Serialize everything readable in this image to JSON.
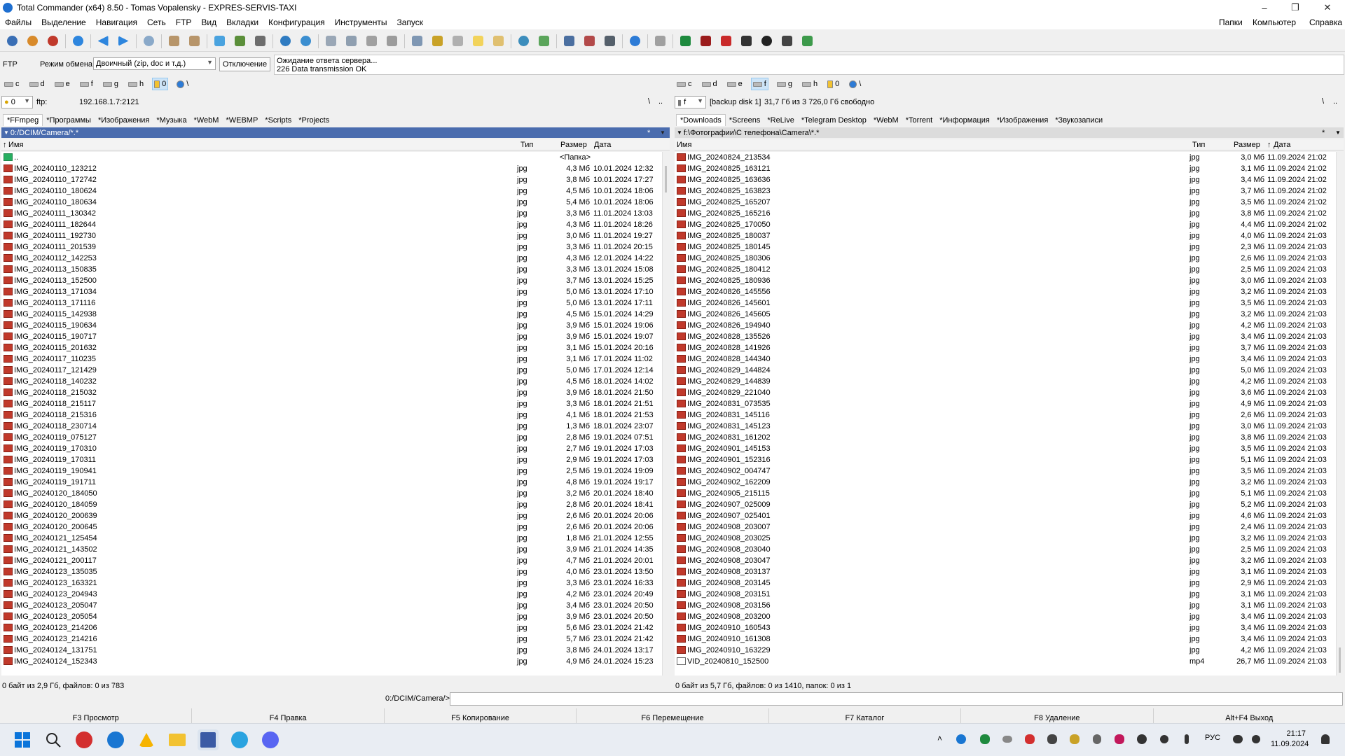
{
  "window": {
    "title": "Total Commander (x64) 8.50 - Tomas Vopalensky - EXPRES-SERVIS-TAXI"
  },
  "menu": {
    "left": [
      "Файлы",
      "Выделение",
      "Навигация",
      "Сеть",
      "FTP",
      "Вид",
      "Вкладки",
      "Конфигурация",
      "Инструменты",
      "Запуск"
    ],
    "right": [
      "Папки",
      "Компьютер",
      "Справка"
    ]
  },
  "ftp": {
    "label": "FTP",
    "mode_label": "Режим обмена",
    "mode_value": "Двоичный (zip, doc и т.д.)",
    "disconnect": "Отключение",
    "log_line1": "Ожидание ответа сервера...",
    "log_line2": "226 Data transmission OK"
  },
  "left": {
    "drives": [
      "c",
      "d",
      "e",
      "f",
      "g",
      "h",
      "0",
      "\\"
    ],
    "active_drive": "0",
    "drive_combo": "0",
    "path_prefix": "ftp:",
    "address": "192.168.1.7:2121",
    "root_btn": "\\",
    "up_btn": "..",
    "tabs": [
      "*FFmpeg",
      "*Программы",
      "*Изображения",
      "*Музыка",
      "*WebM",
      "*WEBMP",
      "*Scripts",
      "*Projects"
    ],
    "active_tab": 0,
    "header_path": "0:/DCIM/Camera/*.*",
    "header_star": "*",
    "col_name": "Имя",
    "col_type": "Тип",
    "col_size": "Размер",
    "col_date": "Дата",
    "parent": {
      "name": "..",
      "size": "<Папка>"
    },
    "files": [
      [
        "IMG_20240110_123212",
        "jpg",
        "4,3 Мб",
        "10.01.2024 12:32"
      ],
      [
        "IMG_20240110_172742",
        "jpg",
        "3,8 Мб",
        "10.01.2024 17:27"
      ],
      [
        "IMG_20240110_180624",
        "jpg",
        "4,5 Мб",
        "10.01.2024 18:06"
      ],
      [
        "IMG_20240110_180634",
        "jpg",
        "5,4 Мб",
        "10.01.2024 18:06"
      ],
      [
        "IMG_20240111_130342",
        "jpg",
        "3,3 Мб",
        "11.01.2024 13:03"
      ],
      [
        "IMG_20240111_182644",
        "jpg",
        "4,3 Мб",
        "11.01.2024 18:26"
      ],
      [
        "IMG_20240111_192730",
        "jpg",
        "3,0 Мб",
        "11.01.2024 19:27"
      ],
      [
        "IMG_20240111_201539",
        "jpg",
        "3,3 Мб",
        "11.01.2024 20:15"
      ],
      [
        "IMG_20240112_142253",
        "jpg",
        "4,3 Мб",
        "12.01.2024 14:22"
      ],
      [
        "IMG_20240113_150835",
        "jpg",
        "3,3 Мб",
        "13.01.2024 15:08"
      ],
      [
        "IMG_20240113_152500",
        "jpg",
        "3,7 Мб",
        "13.01.2024 15:25"
      ],
      [
        "IMG_20240113_171034",
        "jpg",
        "5,0 Мб",
        "13.01.2024 17:10"
      ],
      [
        "IMG_20240113_171116",
        "jpg",
        "5,0 Мб",
        "13.01.2024 17:11"
      ],
      [
        "IMG_20240115_142938",
        "jpg",
        "4,5 Мб",
        "15.01.2024 14:29"
      ],
      [
        "IMG_20240115_190634",
        "jpg",
        "3,9 Мб",
        "15.01.2024 19:06"
      ],
      [
        "IMG_20240115_190717",
        "jpg",
        "3,9 Мб",
        "15.01.2024 19:07"
      ],
      [
        "IMG_20240115_201632",
        "jpg",
        "3,1 Мб",
        "15.01.2024 20:16"
      ],
      [
        "IMG_20240117_110235",
        "jpg",
        "3,1 Мб",
        "17.01.2024 11:02"
      ],
      [
        "IMG_20240117_121429",
        "jpg",
        "5,0 Мб",
        "17.01.2024 12:14"
      ],
      [
        "IMG_20240118_140232",
        "jpg",
        "4,5 Мб",
        "18.01.2024 14:02"
      ],
      [
        "IMG_20240118_215032",
        "jpg",
        "3,9 Мб",
        "18.01.2024 21:50"
      ],
      [
        "IMG_20240118_215117",
        "jpg",
        "3,3 Мб",
        "18.01.2024 21:51"
      ],
      [
        "IMG_20240118_215316",
        "jpg",
        "4,1 Мб",
        "18.01.2024 21:53"
      ],
      [
        "IMG_20240118_230714",
        "jpg",
        "1,3 Мб",
        "18.01.2024 23:07"
      ],
      [
        "IMG_20240119_075127",
        "jpg",
        "2,8 Мб",
        "19.01.2024 07:51"
      ],
      [
        "IMG_20240119_170310",
        "jpg",
        "2,7 Мб",
        "19.01.2024 17:03"
      ],
      [
        "IMG_20240119_170311",
        "jpg",
        "2,9 Мб",
        "19.01.2024 17:03"
      ],
      [
        "IMG_20240119_190941",
        "jpg",
        "2,5 Мб",
        "19.01.2024 19:09"
      ],
      [
        "IMG_20240119_191711",
        "jpg",
        "4,8 Мб",
        "19.01.2024 19:17"
      ],
      [
        "IMG_20240120_184050",
        "jpg",
        "3,2 Мб",
        "20.01.2024 18:40"
      ],
      [
        "IMG_20240120_184059",
        "jpg",
        "2,8 Мб",
        "20.01.2024 18:41"
      ],
      [
        "IMG_20240120_200639",
        "jpg",
        "2,6 Мб",
        "20.01.2024 20:06"
      ],
      [
        "IMG_20240120_200645",
        "jpg",
        "2,6 Мб",
        "20.01.2024 20:06"
      ],
      [
        "IMG_20240121_125454",
        "jpg",
        "1,8 Мб",
        "21.01.2024 12:55"
      ],
      [
        "IMG_20240121_143502",
        "jpg",
        "3,9 Мб",
        "21.01.2024 14:35"
      ],
      [
        "IMG_20240121_200117",
        "jpg",
        "4,7 Мб",
        "21.01.2024 20:01"
      ],
      [
        "IMG_20240123_135035",
        "jpg",
        "4,0 Мб",
        "23.01.2024 13:50"
      ],
      [
        "IMG_20240123_163321",
        "jpg",
        "3,3 Мб",
        "23.01.2024 16:33"
      ],
      [
        "IMG_20240123_204943",
        "jpg",
        "4,2 Мб",
        "23.01.2024 20:49"
      ],
      [
        "IMG_20240123_205047",
        "jpg",
        "3,4 Мб",
        "23.01.2024 20:50"
      ],
      [
        "IMG_20240123_205054",
        "jpg",
        "3,9 Мб",
        "23.01.2024 20:50"
      ],
      [
        "IMG_20240123_214206",
        "jpg",
        "5,6 Мб",
        "23.01.2024 21:42"
      ],
      [
        "IMG_20240123_214216",
        "jpg",
        "5,7 Мб",
        "23.01.2024 21:42"
      ],
      [
        "IMG_20240124_131751",
        "jpg",
        "3,8 Мб",
        "24.01.2024 13:17"
      ],
      [
        "IMG_20240124_152343",
        "jpg",
        "4,9 Мб",
        "24.01.2024 15:23"
      ]
    ],
    "status": "0 байт из 2,9 Гб, файлов: 0 из 783"
  },
  "right": {
    "drives": [
      "c",
      "d",
      "e",
      "f",
      "g",
      "h",
      "0",
      "\\"
    ],
    "active_drive": "f",
    "drive_combo": "f",
    "disk_label": "[backup disk 1]",
    "free_space": "31,7 Гб из 3 726,0 Гб свободно",
    "root_btn": "\\",
    "up_btn": "..",
    "tabs": [
      "*Downloads",
      "*Screens",
      "*ReLive",
      "*Telegram Desktop",
      "*WebM",
      "*Torrent",
      "*Информация",
      "*Изображения",
      "*Звукозаписи"
    ],
    "active_tab": 0,
    "header_path": "f:\\Фотографии\\С телефона\\Camera\\*.*",
    "header_star": "*",
    "col_name": "Имя",
    "col_type": "Тип",
    "col_size": "Размер",
    "col_date": "Дата",
    "files": [
      [
        "IMG_20240824_213534",
        "jpg",
        "3,0 Мб",
        "11.09.2024 21:02"
      ],
      [
        "IMG_20240825_163121",
        "jpg",
        "3,1 Мб",
        "11.09.2024 21:02"
      ],
      [
        "IMG_20240825_163636",
        "jpg",
        "3,4 Мб",
        "11.09.2024 21:02"
      ],
      [
        "IMG_20240825_163823",
        "jpg",
        "3,7 Мб",
        "11.09.2024 21:02"
      ],
      [
        "IMG_20240825_165207",
        "jpg",
        "3,5 Мб",
        "11.09.2024 21:02"
      ],
      [
        "IMG_20240825_165216",
        "jpg",
        "3,8 Мб",
        "11.09.2024 21:02"
      ],
      [
        "IMG_20240825_170050",
        "jpg",
        "4,4 Мб",
        "11.09.2024 21:02"
      ],
      [
        "IMG_20240825_180037",
        "jpg",
        "4,0 Мб",
        "11.09.2024 21:03"
      ],
      [
        "IMG_20240825_180145",
        "jpg",
        "2,3 Мб",
        "11.09.2024 21:03"
      ],
      [
        "IMG_20240825_180306",
        "jpg",
        "2,6 Мб",
        "11.09.2024 21:03"
      ],
      [
        "IMG_20240825_180412",
        "jpg",
        "2,5 Мб",
        "11.09.2024 21:03"
      ],
      [
        "IMG_20240825_180936",
        "jpg",
        "3,0 Мб",
        "11.09.2024 21:03"
      ],
      [
        "IMG_20240826_145556",
        "jpg",
        "3,2 Мб",
        "11.09.2024 21:03"
      ],
      [
        "IMG_20240826_145601",
        "jpg",
        "3,5 Мб",
        "11.09.2024 21:03"
      ],
      [
        "IMG_20240826_145605",
        "jpg",
        "3,2 Мб",
        "11.09.2024 21:03"
      ],
      [
        "IMG_20240826_194940",
        "jpg",
        "4,2 Мб",
        "11.09.2024 21:03"
      ],
      [
        "IMG_20240828_135526",
        "jpg",
        "3,4 Мб",
        "11.09.2024 21:03"
      ],
      [
        "IMG_20240828_141926",
        "jpg",
        "3,7 Мб",
        "11.09.2024 21:03"
      ],
      [
        "IMG_20240828_144340",
        "jpg",
        "3,4 Мб",
        "11.09.2024 21:03"
      ],
      [
        "IMG_20240829_144824",
        "jpg",
        "5,0 Мб",
        "11.09.2024 21:03"
      ],
      [
        "IMG_20240829_144839",
        "jpg",
        "4,2 Мб",
        "11.09.2024 21:03"
      ],
      [
        "IMG_20240829_221040",
        "jpg",
        "3,6 Мб",
        "11.09.2024 21:03"
      ],
      [
        "IMG_20240831_073535",
        "jpg",
        "4,9 Мб",
        "11.09.2024 21:03"
      ],
      [
        "IMG_20240831_145116",
        "jpg",
        "2,6 Мб",
        "11.09.2024 21:03"
      ],
      [
        "IMG_20240831_145123",
        "jpg",
        "3,0 Мб",
        "11.09.2024 21:03"
      ],
      [
        "IMG_20240831_161202",
        "jpg",
        "3,8 Мб",
        "11.09.2024 21:03"
      ],
      [
        "IMG_20240901_145153",
        "jpg",
        "3,5 Мб",
        "11.09.2024 21:03"
      ],
      [
        "IMG_20240901_152316",
        "jpg",
        "5,1 Мб",
        "11.09.2024 21:03"
      ],
      [
        "IMG_20240902_004747",
        "jpg",
        "3,5 Мб",
        "11.09.2024 21:03"
      ],
      [
        "IMG_20240902_162209",
        "jpg",
        "3,2 Мб",
        "11.09.2024 21:03"
      ],
      [
        "IMG_20240905_215115",
        "jpg",
        "5,1 Мб",
        "11.09.2024 21:03"
      ],
      [
        "IMG_20240907_025009",
        "jpg",
        "5,2 Мб",
        "11.09.2024 21:03"
      ],
      [
        "IMG_20240907_025401",
        "jpg",
        "4,6 Мб",
        "11.09.2024 21:03"
      ],
      [
        "IMG_20240908_203007",
        "jpg",
        "2,4 Мб",
        "11.09.2024 21:03"
      ],
      [
        "IMG_20240908_203025",
        "jpg",
        "3,2 Мб",
        "11.09.2024 21:03"
      ],
      [
        "IMG_20240908_203040",
        "jpg",
        "2,5 Мб",
        "11.09.2024 21:03"
      ],
      [
        "IMG_20240908_203047",
        "jpg",
        "3,2 Мб",
        "11.09.2024 21:03"
      ],
      [
        "IMG_20240908_203137",
        "jpg",
        "3,1 Мб",
        "11.09.2024 21:03"
      ],
      [
        "IMG_20240908_203145",
        "jpg",
        "2,9 Мб",
        "11.09.2024 21:03"
      ],
      [
        "IMG_20240908_203151",
        "jpg",
        "3,1 Мб",
        "11.09.2024 21:03"
      ],
      [
        "IMG_20240908_203156",
        "jpg",
        "3,1 Мб",
        "11.09.2024 21:03"
      ],
      [
        "IMG_20240908_203200",
        "jpg",
        "3,4 Мб",
        "11.09.2024 21:03"
      ],
      [
        "IMG_20240910_160543",
        "jpg",
        "3,4 Мб",
        "11.09.2024 21:03"
      ],
      [
        "IMG_20240910_161308",
        "jpg",
        "3,4 Мб",
        "11.09.2024 21:03"
      ],
      [
        "IMG_20240910_163229",
        "jpg",
        "4,2 Мб",
        "11.09.2024 21:03"
      ],
      [
        "VID_20240810_152500",
        "mp4",
        "26,7 Мб",
        "11.09.2024 21:03"
      ]
    ],
    "status": "0 байт из 5,7 Гб, файлов: 0 из 1410, папок: 0 из 1"
  },
  "cmdline": {
    "path": "0:/DCIM/Camera/>"
  },
  "fkeys": [
    "F3 Просмотр",
    "F4 Правка",
    "F5 Копирование",
    "F6 Перемещение",
    "F7 Каталог",
    "F8 Удаление",
    "Alt+F4 Выход"
  ],
  "tray": {
    "lang": "РУС",
    "time": "21:17",
    "date": "11.09.2024"
  },
  "colors": {
    "accent": "#4a6cae",
    "select": "#cde4f7"
  }
}
